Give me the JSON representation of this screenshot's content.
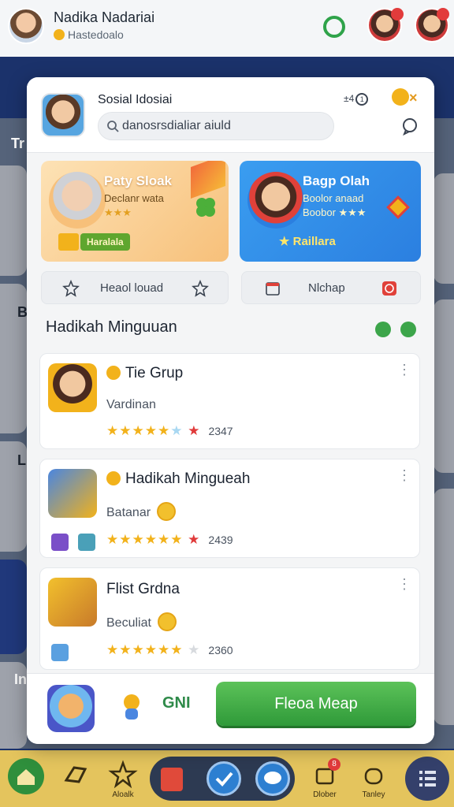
{
  "profile": {
    "name": "Nadika  Nadariai",
    "status": "Hastedoalo"
  },
  "background_left_letters": [
    "Tr",
    "B",
    "Li",
    "In"
  ],
  "modal": {
    "title": "Sosial Idosiai",
    "search_value": "danosrsdialiar aiuld",
    "count_label": "±4",
    "close_label": "×",
    "feature_cards": [
      {
        "title": "Paty Sloak",
        "subtitle": "Declanr wata",
        "stars": "★★★",
        "badge": "Haralala"
      },
      {
        "title": "Bagp Olah",
        "subtitle": "Boolor anaad",
        "subtitle2": "Boobor ★★★",
        "badge": "★ Raillara"
      }
    ],
    "chips": [
      {
        "label": "Heaol louad"
      },
      {
        "label": "Nlchap"
      }
    ],
    "section_title": "Hadikah Minguuan",
    "list_items": [
      {
        "title": "Tie Grup",
        "subtitle": "Vardinan",
        "count": "2347"
      },
      {
        "title": "Hadikah Mingueah",
        "subtitle": "Batanar",
        "count": "2439"
      },
      {
        "title": "Flist Grdna",
        "subtitle": "Beculiat",
        "count": "2360"
      }
    ],
    "footer": {
      "label": "GNI",
      "button_label": "Fleoa Meap"
    }
  },
  "bottom_nav": {
    "labels": [
      "Aloalk",
      "Dlober",
      "Tanley"
    ],
    "badge": "8"
  },
  "colors": {
    "accent_green": "#2f9a39",
    "accent_blue": "#2b7fe0",
    "accent_orange": "#f7c07a",
    "star": "#f2b21b",
    "nav_yellow": "#e4c45d"
  }
}
